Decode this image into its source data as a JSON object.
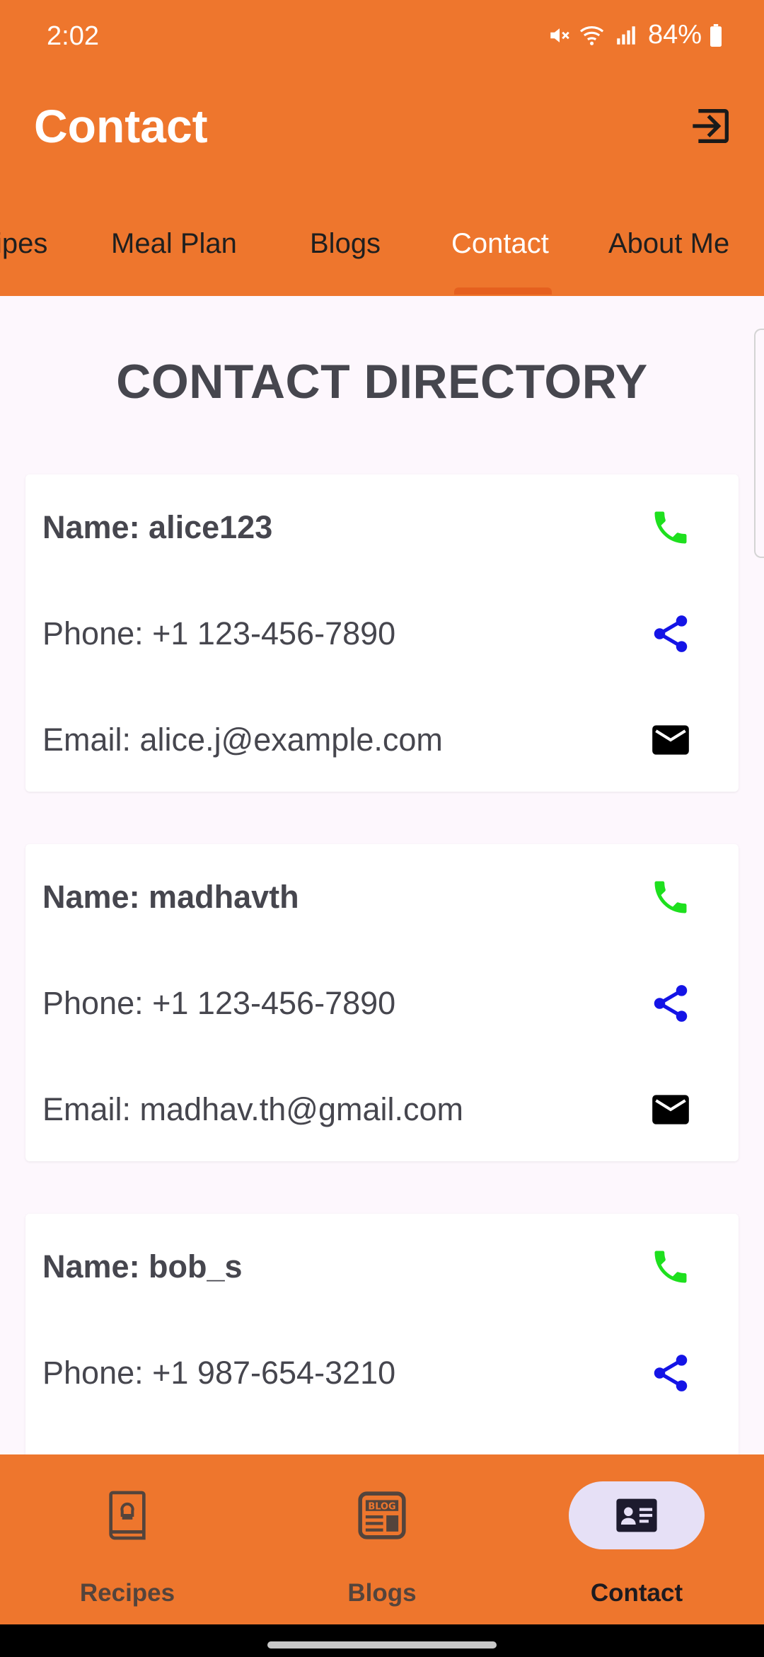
{
  "status": {
    "time": "2:02",
    "battery": "84%"
  },
  "app": {
    "title": "Contact"
  },
  "tabs": [
    {
      "label": "ipes"
    },
    {
      "label": "Meal Plan"
    },
    {
      "label": "Blogs"
    },
    {
      "label": "Contact"
    },
    {
      "label": "About Me"
    }
  ],
  "page": {
    "heading": "CONTACT DIRECTORY"
  },
  "contacts": [
    {
      "name": "Name: alice123",
      "phone": "Phone: +1 123-456-7890",
      "email": "Email: alice.j@example.com"
    },
    {
      "name": "Name: madhavth",
      "phone": "Phone: +1 123-456-7890",
      "email": "Email: madhav.th@gmail.com"
    },
    {
      "name": "Name: bob_s",
      "phone": "Phone: +1 987-654-3210"
    }
  ],
  "bottom_nav": [
    {
      "label": "Recipes",
      "icon": "recipe-book-icon"
    },
    {
      "label": "Blogs",
      "icon": "blog-icon"
    },
    {
      "label": "Contact",
      "icon": "contact-card-icon"
    }
  ],
  "colors": {
    "primary": "#ee762d",
    "call": "#1ee01e",
    "share": "#1414e6",
    "email": "#000000",
    "active_pill": "#e6e0f6"
  }
}
